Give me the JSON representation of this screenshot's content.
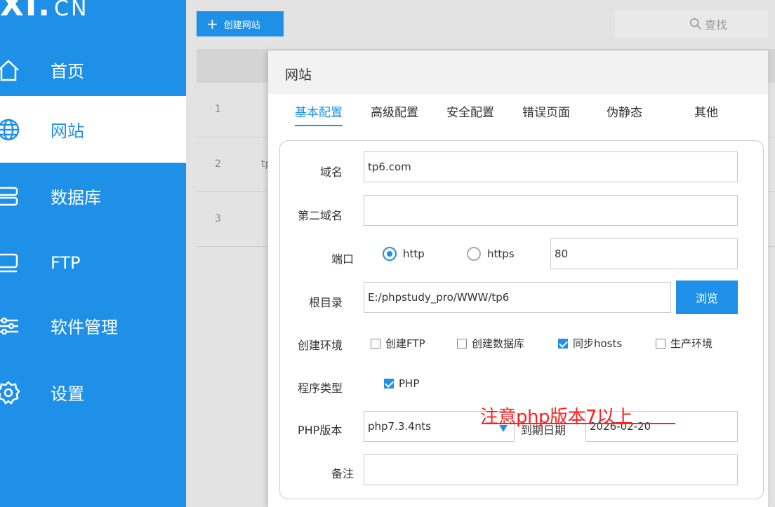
{
  "sidebar": {
    "logo_main": "XI.",
    "logo_cn": "CN",
    "items": [
      {
        "label": "首页",
        "icon": "home-icon"
      },
      {
        "label": "网站",
        "icon": "globe-icon",
        "active": true
      },
      {
        "label": "数据库",
        "icon": "database-icon"
      },
      {
        "label": "FTP",
        "icon": "ftp-icon"
      },
      {
        "label": "软件管理",
        "icon": "sliders-icon"
      },
      {
        "label": "设置",
        "icon": "gear-icon"
      }
    ]
  },
  "toolbar": {
    "create_label": "创建网站",
    "search_label": "查找"
  },
  "table": {
    "rows": [
      {
        "num": "1",
        "fragment": ""
      },
      {
        "num": "2",
        "fragment": "tp"
      },
      {
        "num": "3",
        "fragment": ""
      }
    ]
  },
  "modal": {
    "title": "网站",
    "tabs": [
      "基本配置",
      "高级配置",
      "安全配置",
      "错误页面",
      "伪静态",
      "其他"
    ],
    "active_tab": 0,
    "form": {
      "domain_label": "域名",
      "domain_value": "tp6.com",
      "second_domain_label": "第二域名",
      "second_domain_value": "",
      "port_label": "端口",
      "protocol_options": [
        "http",
        "https"
      ],
      "protocol_selected": "http",
      "port_value": "80",
      "root_label": "根目录",
      "root_value": "E:/phpstudy_pro/WWW/tp6",
      "browse_label": "浏览",
      "env_label": "创建环境",
      "env_options": [
        {
          "label": "创建FTP",
          "checked": false
        },
        {
          "label": "创建数据库",
          "checked": false
        },
        {
          "label": "同步hosts",
          "checked": true
        },
        {
          "label": "生产环境",
          "checked": false
        }
      ],
      "program_type_label": "程序类型",
      "program_type_option": "PHP",
      "program_type_checked": true,
      "php_version_label": "PHP版本",
      "php_version_value": "php7.3.4nts",
      "expire_label": "到期日期",
      "expire_value": "2026-02-20",
      "note_label": "备注",
      "note_value": ""
    },
    "annotation": "注意php版本7以上"
  },
  "colors": {
    "accent": "#1e90e8",
    "annotation": "#ff2020"
  }
}
